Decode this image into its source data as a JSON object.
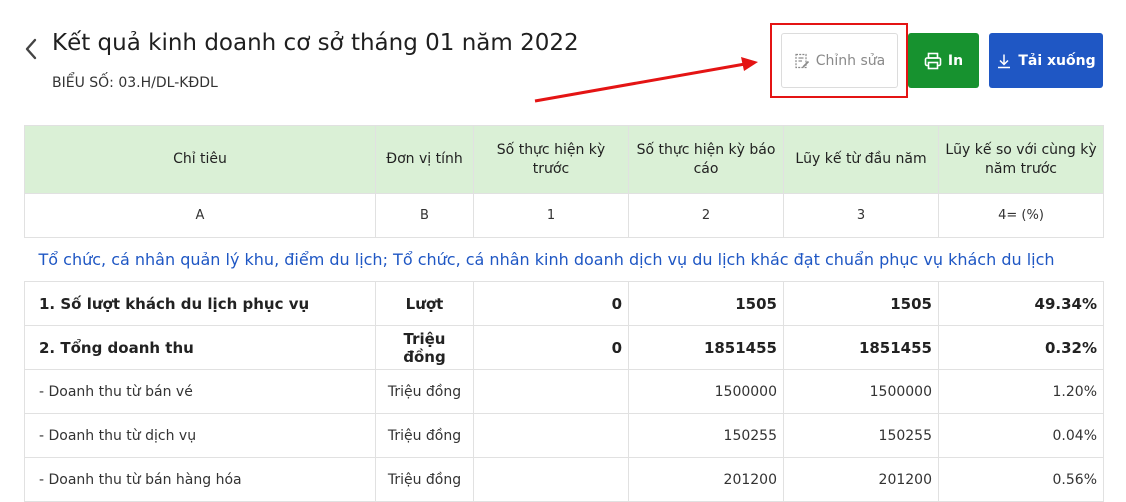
{
  "header": {
    "title": "Kết quả kinh doanh cơ sở tháng 01 năm 2022",
    "form_code": "BIỂU SỐ: 03.H/DL-KĐDL"
  },
  "toolbar": {
    "edit_label": "Chỉnh sửa",
    "print_label": "In",
    "download_label": "Tải xuống"
  },
  "colors": {
    "print": "#17922f",
    "download": "#1f57c4",
    "header_bg": "#daf0d6",
    "annotation": "#e41414"
  },
  "table": {
    "columns": [
      "Chỉ tiêu",
      "Đơn vị tính",
      "Số thực hiện kỳ trước",
      "Số thực hiện kỳ báo cáo",
      "Lũy kế từ đầu năm",
      "Lũy kế so với cùng kỳ năm trước"
    ],
    "codes": [
      "A",
      "B",
      "1",
      "2",
      "3",
      "4= (%)"
    ],
    "section": "Tổ chức, cá nhân quản lý khu, điểm du lịch; Tổ chức, cá nhân kinh doanh dịch vụ du lịch khác đạt chuẩn phục vụ khách du lịch",
    "rows": [
      [
        "1. Số lượt khách du lịch phục vụ",
        "Lượt",
        "0",
        "1505",
        "1505",
        "49.34%"
      ],
      [
        "2. Tổng doanh thu",
        "Triệu đồng",
        "0",
        "1851455",
        "1851455",
        "0.32%"
      ],
      [
        "- Doanh thu từ bán vé",
        "Triệu đồng",
        "",
        "1500000",
        "1500000",
        "1.20%"
      ],
      [
        "- Doanh thu từ dịch vụ",
        "Triệu đồng",
        "",
        "150255",
        "150255",
        "0.04%"
      ],
      [
        "- Doanh thu từ bán hàng hóa",
        "Triệu đồng",
        "",
        "201200",
        "201200",
        "0.56%"
      ]
    ]
  }
}
